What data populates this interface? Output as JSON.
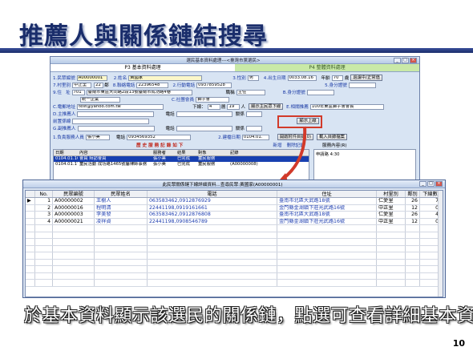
{
  "slide": {
    "title": "推薦人與關係鏈結搜尋",
    "caption": "於基本資料顯示該選民的關係鏈，點選可查看詳細基本資料",
    "page_number": "10"
  },
  "main_window": {
    "title": "選民基本資料處理---<臺灣市黨選民>",
    "tabs": [
      "P3 基本資料處理",
      "P4 整體資料處理"
    ],
    "fields": {
      "voter_no_label": "1.民眾編號",
      "voter_no": "A00000001",
      "name_label": "2.姓名",
      "name": "黃國家",
      "gender_label": "3.性別",
      "gender": "男",
      "birth_label": "4.出生日期",
      "birth": "0033.08.16",
      "age_label": "年齡",
      "age": "70",
      "status": "歲",
      "status_btn": "過濾中/正常值",
      "village_label": "7.村里別",
      "village": "中正里",
      "neighbor": "22",
      "neighbor_unit": "鄰",
      "home_phone_label": "8.聯絡電話",
      "home_phone": "22396548",
      "mobile_label": "2.行動電話",
      "mobile": "0937859528",
      "id_label": "5.身分證號",
      "address_label": "9.住",
      "address_label2": "址",
      "address_zip": "701",
      "address": "臺南市東區大同路2段13號臺南市成功路4巷",
      "company_label": "職稱",
      "company": "主任",
      "household_label": "B.身分證號",
      "email_label": "C.電郵地址",
      "email": "test@yahoo.com.tw",
      "member_label": "統一企業",
      "group_label": "C.社團會員",
      "group": "獅子會",
      "affiliate_label": "D.主推薦人",
      "referral_btn": "顯示主民眾下線",
      "relation_label": "E.相關推薦",
      "relation_value": "100年東區獅子會會長",
      "show_btn": "顯示上線",
      "phone2_label": "電話",
      "relation2_label": "關係",
      "level_value": "4",
      "count_value": "19",
      "level_unit": "層",
      "count_unit": "人",
      "relation3_label": "關係",
      "sec_label": "前置係線",
      "cate_label": "G.副推薦人",
      "contact_person_label": "1.負責服務人員",
      "contact_person": "張小美",
      "contact_phone_label": "電話",
      "contact_phone": "0934569352",
      "date_label": "2.建檔日期",
      "date": "0104.01.",
      "open_btn": "開啟附件目錄(0)",
      "import_btn": "載入目錄檔案",
      "note_label": "服務內容(R)",
      "history_label": "歷 史 服 務 記 錄 如 下",
      "add_label": "新增",
      "edit_label": "刪除記錄",
      "goto_label": "查看目錄",
      "right_list_item": "申請路 4:30"
    },
    "history_headers": [
      "日期",
      "內容",
      "服務者",
      "結果",
      "對象",
      "記錄"
    ],
    "history_rows": [
      [
        "0104.01.16",
        "會員 拜訪會員",
        "張小美",
        "已完成",
        "童民服務",
        ""
      ],
      [
        "0104.01.17",
        "童民活動 成功路1465號屬律師事務",
        "張小美",
        "已完成",
        "童民服務",
        "(A00000008)"
      ]
    ]
  },
  "popup": {
    "title": "此民眾關係鏈下線詳細資料...查尋民眾:黃國家(A00000001)",
    "headers": [
      "",
      "No.",
      "民眾編號",
      "民眾姓名",
      "電話",
      "住址",
      "村里別",
      "鄰別",
      "下線數"
    ],
    "rows": [
      {
        "no": "1",
        "id": "A00000002",
        "name": "王樹人",
        "phone": "063583462,0912876929",
        "addr": "臺南市北區大武路18號",
        "village": "仁愛里",
        "lin": "26",
        "down": "7",
        "selected": true
      },
      {
        "no": "2",
        "id": "A00000016",
        "name": "程明清",
        "phone": "22441198,0919161661",
        "addr": "金門縣金湖鎮下莊光武路16號",
        "village": "中正里",
        "lin": "12",
        "down": "0",
        "selected": false
      },
      {
        "no": "3",
        "id": "A00000003",
        "name": "李美發",
        "phone": "063583462,0912876808",
        "addr": "臺南市北區大武路18號",
        "village": "仁愛里",
        "lin": "26",
        "down": "4",
        "selected": false
      },
      {
        "no": "4",
        "id": "A00000021",
        "name": "凌祥貞",
        "phone": "22441198,0908546789",
        "addr": "金門縣金湖鎮下莊光武路16號",
        "village": "中正里",
        "lin": "12",
        "down": "0",
        "selected": false
      }
    ],
    "selected_marker": "▶"
  },
  "colors": {
    "title": "#1a2d6b",
    "highlight": "#d23a2a",
    "select_row": "#1840b0"
  }
}
